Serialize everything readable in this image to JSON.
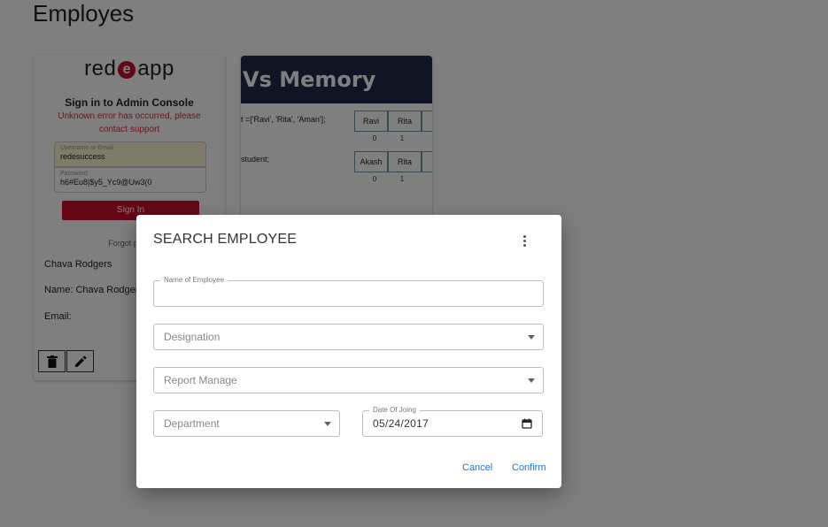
{
  "page": {
    "title": "Employes"
  },
  "card1": {
    "logo_left": "red",
    "logo_e": "e",
    "logo_right": "app",
    "signin_title": "Sign in to Admin Console",
    "error_message": "Unknown error has occurred, please contact support",
    "username_label": "Username or Email",
    "username_value": "redesuccess",
    "password_label": "Password",
    "password_value": "h6#Eu8|$y5_Yc9@Uw3(0",
    "signin_button": "Sign In",
    "forgot_text": "Forgot pass",
    "employee_name": "Chava Rodgers",
    "name_row": "Name:  Chava Rodgers",
    "email_row": "Email:"
  },
  "card2": {
    "header_title": "Vs Memory",
    "code_line_1": "t =['Ravi', 'Rita', 'Aman'];",
    "code_line_2": "student;",
    "row1": [
      "Ravi",
      "Rita",
      "A"
    ],
    "row2": [
      "Akash",
      "Rita",
      "A"
    ],
    "indices": [
      "0",
      "1"
    ]
  },
  "dialog": {
    "title": "SEARCH EMPLOYEE",
    "name_label": "Name of Employee",
    "name_value": "",
    "designation_placeholder": "Designation",
    "report_placeholder": "Report Manage",
    "department_placeholder": "Department",
    "date_label": "Date Of Joing",
    "date_value": "05/24/2017",
    "cancel_label": "Cancel",
    "confirm_label": "Confirm"
  },
  "colors": {
    "accent": "#1976d2",
    "brand_red": "#c8102e",
    "error_red": "#d32f2f",
    "header_navy": "#1f2a44"
  },
  "icons": [
    "delete-icon",
    "edit-icon",
    "more-vert-icon",
    "dropdown-caret-icon",
    "calendar-icon"
  ]
}
